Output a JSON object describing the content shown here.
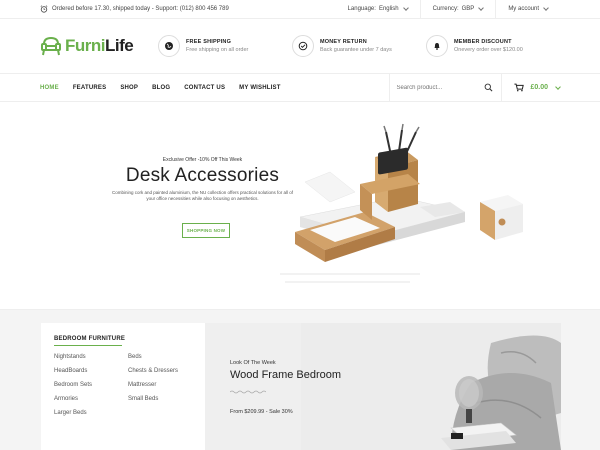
{
  "topbar": {
    "notice": "Ordered before 17.30, shipped today - Support: (012) 800 456 789",
    "language_label": "Language:",
    "language_value": "English",
    "currency_label": "Currency:",
    "currency_value": "GBP",
    "account": "My account"
  },
  "logo": {
    "part1": "Furni",
    "part2": "Life"
  },
  "features": [
    {
      "title": "FREE SHIPPING",
      "sub": "Free shipping on all order",
      "icon": "globe-icon"
    },
    {
      "title": "MONEY RETURN",
      "sub": "Back guarantee under 7 days",
      "icon": "check-circle-icon"
    },
    {
      "title": "MEMBER DISCOUNT",
      "sub": "Onevery order over $120.00",
      "icon": "bell-icon"
    }
  ],
  "nav": {
    "items": [
      "HOME",
      "FEATURES",
      "SHOP",
      "BLOG",
      "CONTACT US",
      "MY WISHLIST"
    ],
    "search_placeholder": "Search product...",
    "cart_total": "£0.00"
  },
  "hero": {
    "kicker": "Exclusive Offer -10% Off This Week",
    "title": "Desk Accessories",
    "description": "Combining cork and painted aluminium, the NU collection offers practical solutions for all of your office necessities while also focusing on aesthetics.",
    "button": "SHOPPING NOW"
  },
  "categories": {
    "title": "BEDROOM FURNITURE",
    "col1": [
      "Nightstands",
      "HeadBoards",
      "Bedroom Sets",
      "Armories",
      "Larger Beds"
    ],
    "col2": [
      "Beds",
      "Chests & Dressers",
      "Mattresser",
      "Small Beds"
    ]
  },
  "promo": {
    "kicker": "Look Of The Week",
    "title": "Wood Frame Bedroom",
    "price": "From  $209.99 - Sale 30%"
  },
  "colors": {
    "accent": "#6ab04c"
  }
}
